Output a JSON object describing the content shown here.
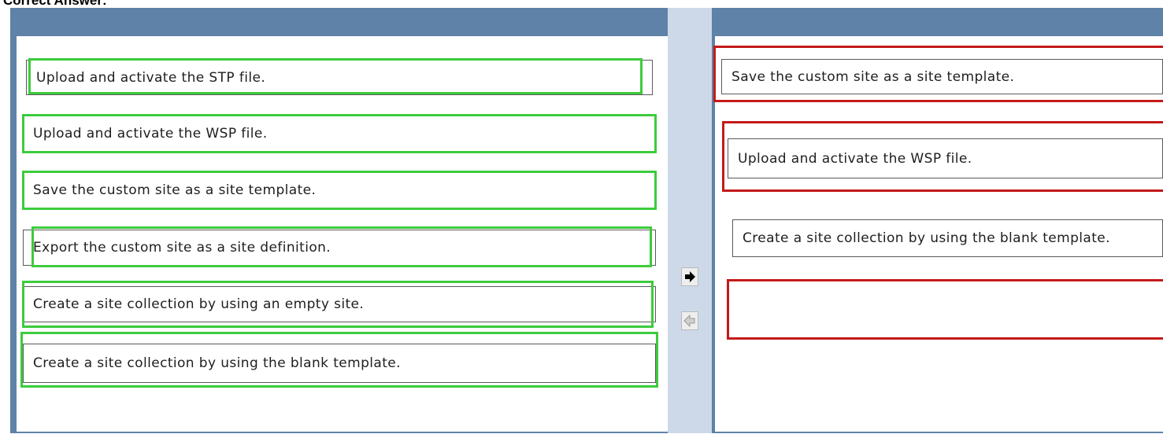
{
  "header": {
    "title": "Correct Answer:"
  },
  "left_items": [
    "Upload and activate the STP file.",
    "Upload and activate the WSP file.",
    "Save the custom site as a site template.",
    "Export the custom site as a site definition.",
    "Create a site collection by using an empty site.",
    "Create a site collection by using the blank template."
  ],
  "answer_items": [
    "Save the custom site as a site template.",
    "Upload and activate the WSP file.",
    "Create a site collection by using the blank template.",
    ""
  ],
  "icons": {
    "move_right": "arrow-right-icon",
    "move_left": "arrow-left-icon"
  },
  "colors": {
    "frame": "#5e82a8",
    "divider": "#cdd9e8",
    "highlight_green": "#3ccc3c",
    "highlight_red": "#c41a1a"
  }
}
